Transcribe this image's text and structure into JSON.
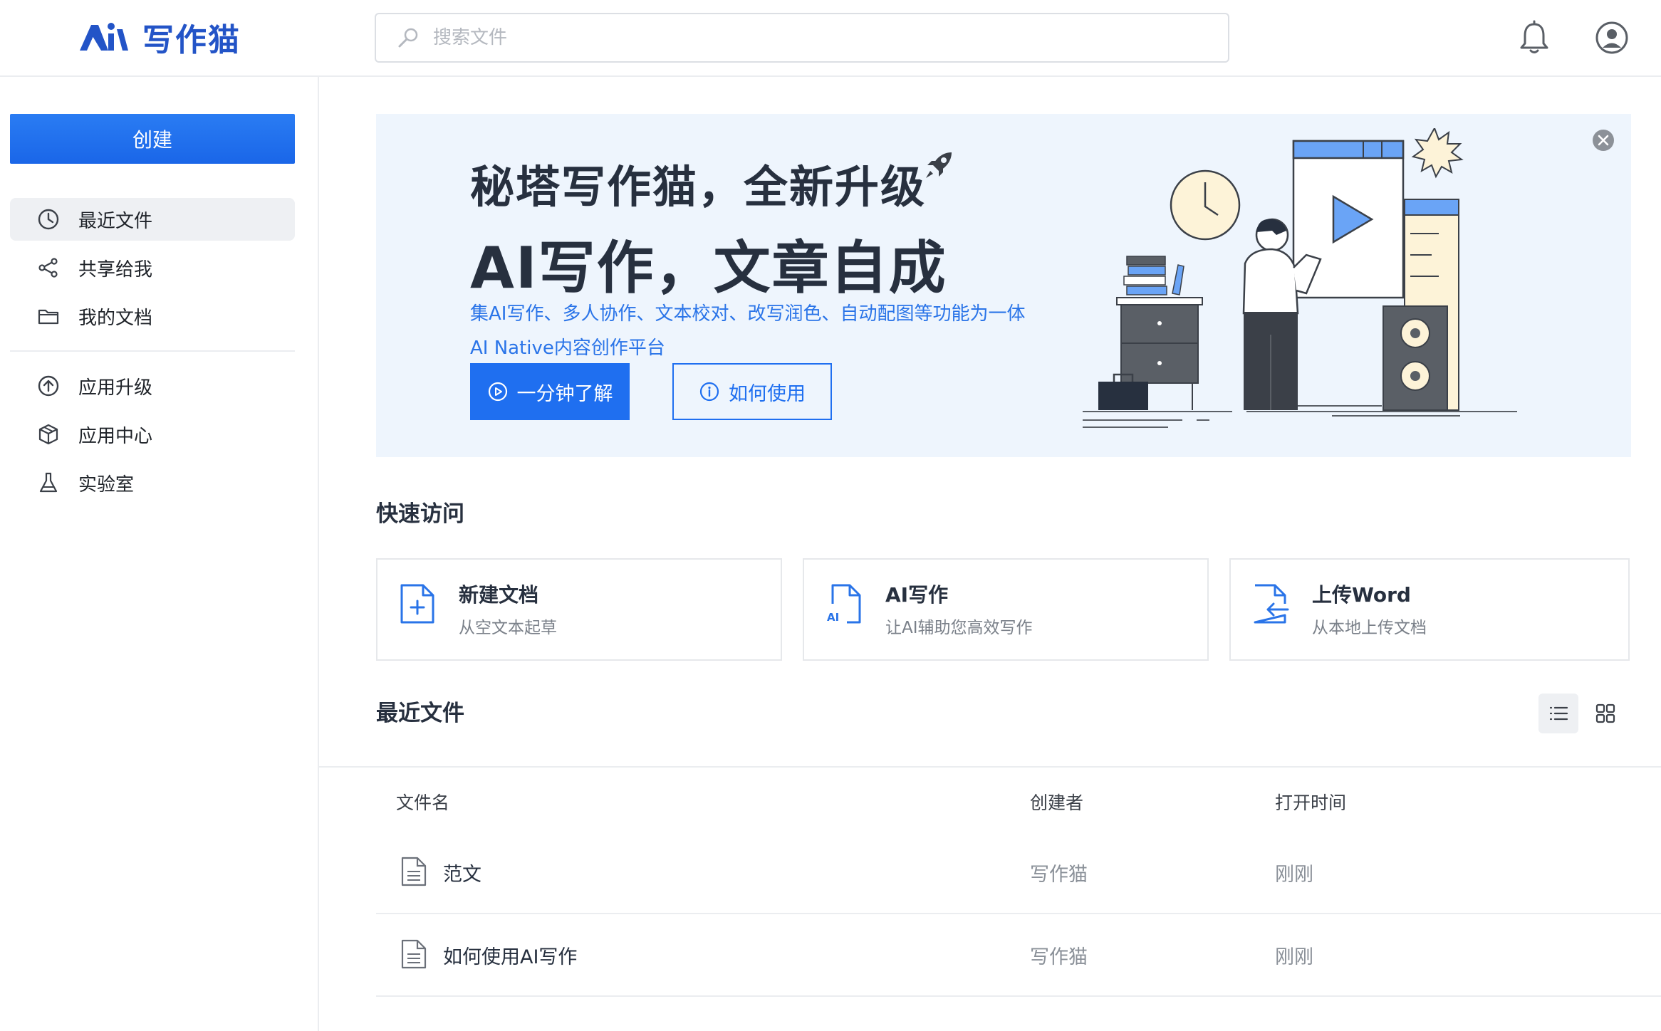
{
  "app": {
    "name": "写作猫",
    "brand_color": "#2354c7",
    "accent_color": "#1f6ff0"
  },
  "search": {
    "placeholder": "搜索文件",
    "icon": "search-icon"
  },
  "header": {
    "notification_icon": "bell-icon",
    "avatar_icon": "user-avatar-icon"
  },
  "sidebar": {
    "create_label": "创建",
    "items": [
      {
        "label": "最近文件",
        "icon": "clock-icon",
        "active": true
      },
      {
        "label": "共享给我",
        "icon": "share-icon"
      },
      {
        "label": "我的文档",
        "icon": "folder-icon"
      },
      {
        "label": "应用升级",
        "icon": "upgrade-icon"
      },
      {
        "label": "应用中心",
        "icon": "cube-icon"
      },
      {
        "label": "实验室",
        "icon": "flask-icon"
      }
    ]
  },
  "banner": {
    "title1": "秘塔写作猫，全新升级",
    "title2": "AI写作，文章自成",
    "subtitle1": "集AI写作、多人协作、文本校对、改写润色、自动配图等功能为一体",
    "subtitle2": "AI Native内容创作平台",
    "button_primary": "一分钟了解",
    "button_secondary": "如何使用"
  },
  "quick_access": {
    "title": "快速访问",
    "cards": [
      {
        "title": "新建文档",
        "subtitle": "从空文本起草",
        "icon": "new-document-icon"
      },
      {
        "title": "AI写作",
        "subtitle": "让AI辅助您高效写作",
        "icon": "ai-document-icon"
      },
      {
        "title": "上传Word",
        "subtitle": "从本地上传文档",
        "icon": "upload-document-icon"
      }
    ]
  },
  "recent": {
    "title": "最近文件",
    "columns": [
      "文件名",
      "创建者",
      "打开时间"
    ],
    "rows": [
      {
        "name": "范文",
        "creator": "写作猫",
        "time": "刚刚"
      },
      {
        "name": "如何使用AI写作",
        "creator": "写作猫",
        "time": "刚刚"
      }
    ]
  }
}
